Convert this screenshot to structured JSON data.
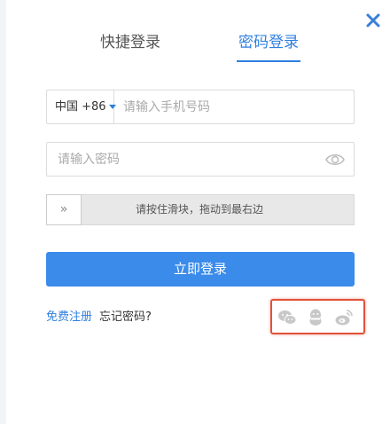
{
  "window": {
    "close_icon": "close-icon"
  },
  "tabs": [
    {
      "label": "快捷登录",
      "active": false
    },
    {
      "label": "密码登录",
      "active": true
    }
  ],
  "phone": {
    "country_code": "中国 +86",
    "placeholder": "请输入手机号码",
    "value": ""
  },
  "password": {
    "placeholder": "请输入密码",
    "value": "",
    "toggle_icon": "eye-icon"
  },
  "slider": {
    "handle_glyph": "»",
    "text": "请按住滑块，拖动到最右边"
  },
  "login_button": "立即登录",
  "links": {
    "register": "免费注册",
    "forgot": "忘记密码?"
  },
  "social": [
    {
      "name": "wechat-icon"
    },
    {
      "name": "qq-icon"
    },
    {
      "name": "weibo-icon"
    }
  ],
  "colors": {
    "accent": "#3a8bea",
    "link": "#2f7fe0",
    "highlight": "#e0523a",
    "social_icon": "#c8c8c8"
  }
}
